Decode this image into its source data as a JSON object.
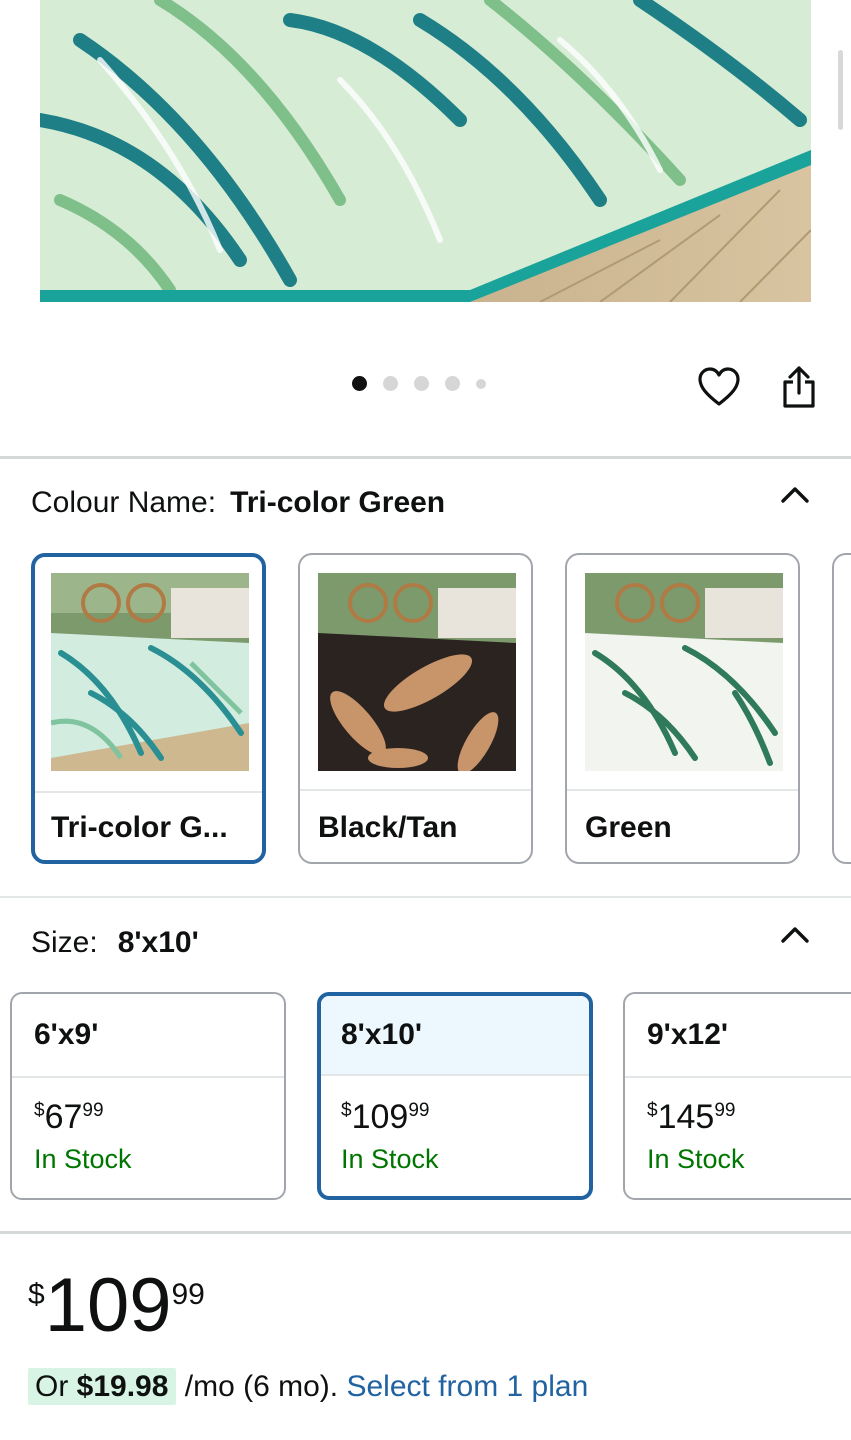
{
  "gallery": {
    "dots_total": 5,
    "dots_active_index": 0
  },
  "colour": {
    "label": "Colour Name:",
    "selected_value": "Tri-color Green",
    "options": [
      {
        "label": "Tri-color G...",
        "selected": true
      },
      {
        "label": "Black/Tan",
        "selected": false
      },
      {
        "label": "Green",
        "selected": false
      }
    ]
  },
  "size": {
    "label": "Size:",
    "selected_value": "8'x10'",
    "options": [
      {
        "name": "6'x9'",
        "currency": "$",
        "whole": "67",
        "fraction": "99",
        "stock": "In Stock",
        "selected": false
      },
      {
        "name": "8'x10'",
        "currency": "$",
        "whole": "109",
        "fraction": "99",
        "stock": "In Stock",
        "selected": true
      },
      {
        "name": "9'x12'",
        "currency": "$",
        "whole": "145",
        "fraction": "99",
        "stock": "In Stock",
        "selected": false
      }
    ]
  },
  "price": {
    "currency": "$",
    "whole": "109",
    "fraction": "99"
  },
  "installment": {
    "prefix": "Or ",
    "amount": "$19.98",
    "terms": " /mo (6 mo). ",
    "link": "Select from 1 plan"
  },
  "icons": {
    "favorite": "heart-icon",
    "share": "share-icon",
    "collapse": "chevron-up-icon"
  },
  "colors": {
    "accent_blue": "#2162a1",
    "stock_green": "#007600",
    "highlight_green": "#d7f4e5",
    "selected_bg": "#edf7fe"
  }
}
